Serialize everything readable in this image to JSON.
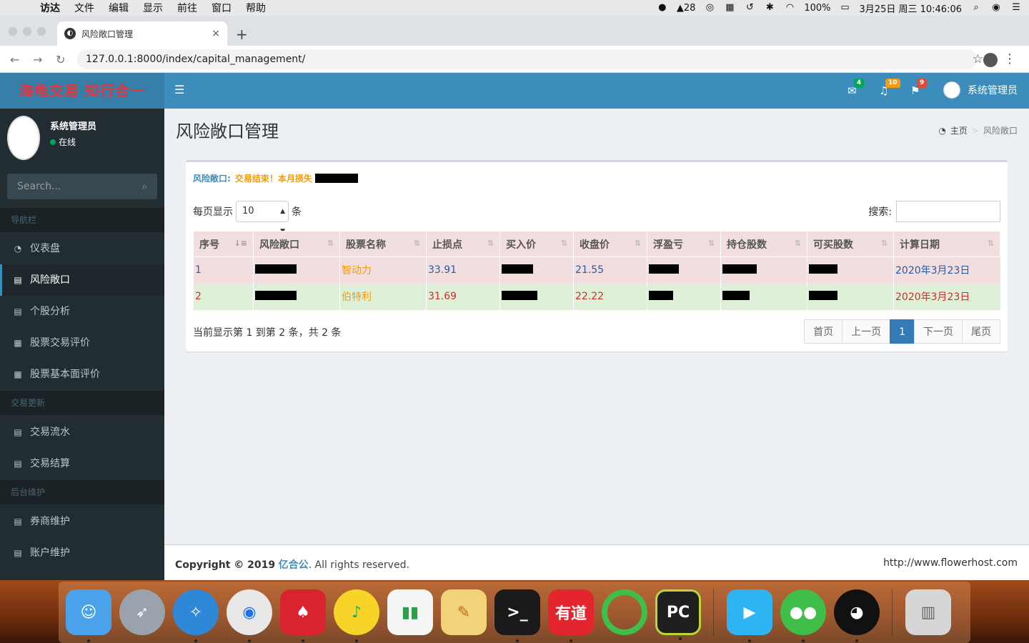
{
  "menubar": {
    "items": [
      "访达",
      "文件",
      "编辑",
      "显示",
      "前往",
      "窗口",
      "帮助"
    ],
    "status": {
      "notif_count": "28",
      "battery": "100%",
      "datetime": "3月25日 周三  10:46:06"
    }
  },
  "browser": {
    "tab_title": "风险敞口管理",
    "url": "127.0.0.1:8000/index/capital_management/"
  },
  "header": {
    "logo": "海龟交易 知行合一",
    "mail_badge": "4",
    "bell_badge": "10",
    "flag_badge": "9",
    "user_name": "系统管理员",
    "colors": {
      "mail_badge": "#00a65a",
      "bell_badge": "#f39c12",
      "flag_badge": "#dd4b39"
    }
  },
  "sidebar": {
    "user_name": "系统管理员",
    "user_status": "在线",
    "search_placeholder": "Search...",
    "sections": [
      {
        "title": "导航栏",
        "items": [
          {
            "label": "仪表盘",
            "icon": "dashboard-icon"
          },
          {
            "label": "风险敞口",
            "icon": "file-icon",
            "active": true
          },
          {
            "label": "个股分析",
            "icon": "file-icon"
          },
          {
            "label": "股票交易评价",
            "icon": "table-icon"
          },
          {
            "label": "股票基本面评价",
            "icon": "table-icon"
          }
        ]
      },
      {
        "title": "交易更新",
        "items": [
          {
            "label": "交易流水",
            "icon": "file-icon"
          },
          {
            "label": "交易结算",
            "icon": "file-icon"
          }
        ]
      },
      {
        "title": "后台维护",
        "items": [
          {
            "label": "券商维护",
            "icon": "file-icon"
          },
          {
            "label": "账户维护",
            "icon": "file-icon"
          }
        ]
      }
    ]
  },
  "content": {
    "page_title": "风险敞口管理",
    "breadcrumb": {
      "home": "主页",
      "current": "风险敞口"
    },
    "risk_label": "风险敞口:",
    "risk_message": "交易结束！本月损失",
    "length_label_before": "每页显示",
    "length_value": "10",
    "length_label_after": "条",
    "search_label": "搜索:",
    "columns": [
      "序号",
      "风险敞口",
      "股票名称",
      "止损点",
      "买入价",
      "收盘价",
      "浮盈亏",
      "持仓股数",
      "可买股数",
      "计算日期"
    ],
    "rows": [
      {
        "idx": "1",
        "name": "智动力",
        "stop": "33.91",
        "close": "21.55",
        "date": "2020年3月23日"
      },
      {
        "idx": "2",
        "name": "伯特利",
        "stop": "31.69",
        "close": "22.22",
        "date": "2020年3月23日"
      }
    ],
    "info_text": "当前显示第 1 到第 2 条，共 2 条",
    "pager": {
      "first": "首页",
      "prev": "上一页",
      "current": "1",
      "next": "下一页",
      "last": "尾页"
    }
  },
  "footer": {
    "copyright_prefix": "Copyright © 2019",
    "brand": "亿合公",
    "suffix": ". All rights reserved.",
    "site": "http://www.flowerhost.com"
  },
  "dock": {
    "apps": [
      "finder",
      "launchpad",
      "safari",
      "chrome",
      "poker",
      "music",
      "numbers",
      "pages",
      "terminal",
      "youdao",
      "green-ring",
      "pycharm",
      "video-player",
      "wechat",
      "qq",
      "trash"
    ]
  }
}
